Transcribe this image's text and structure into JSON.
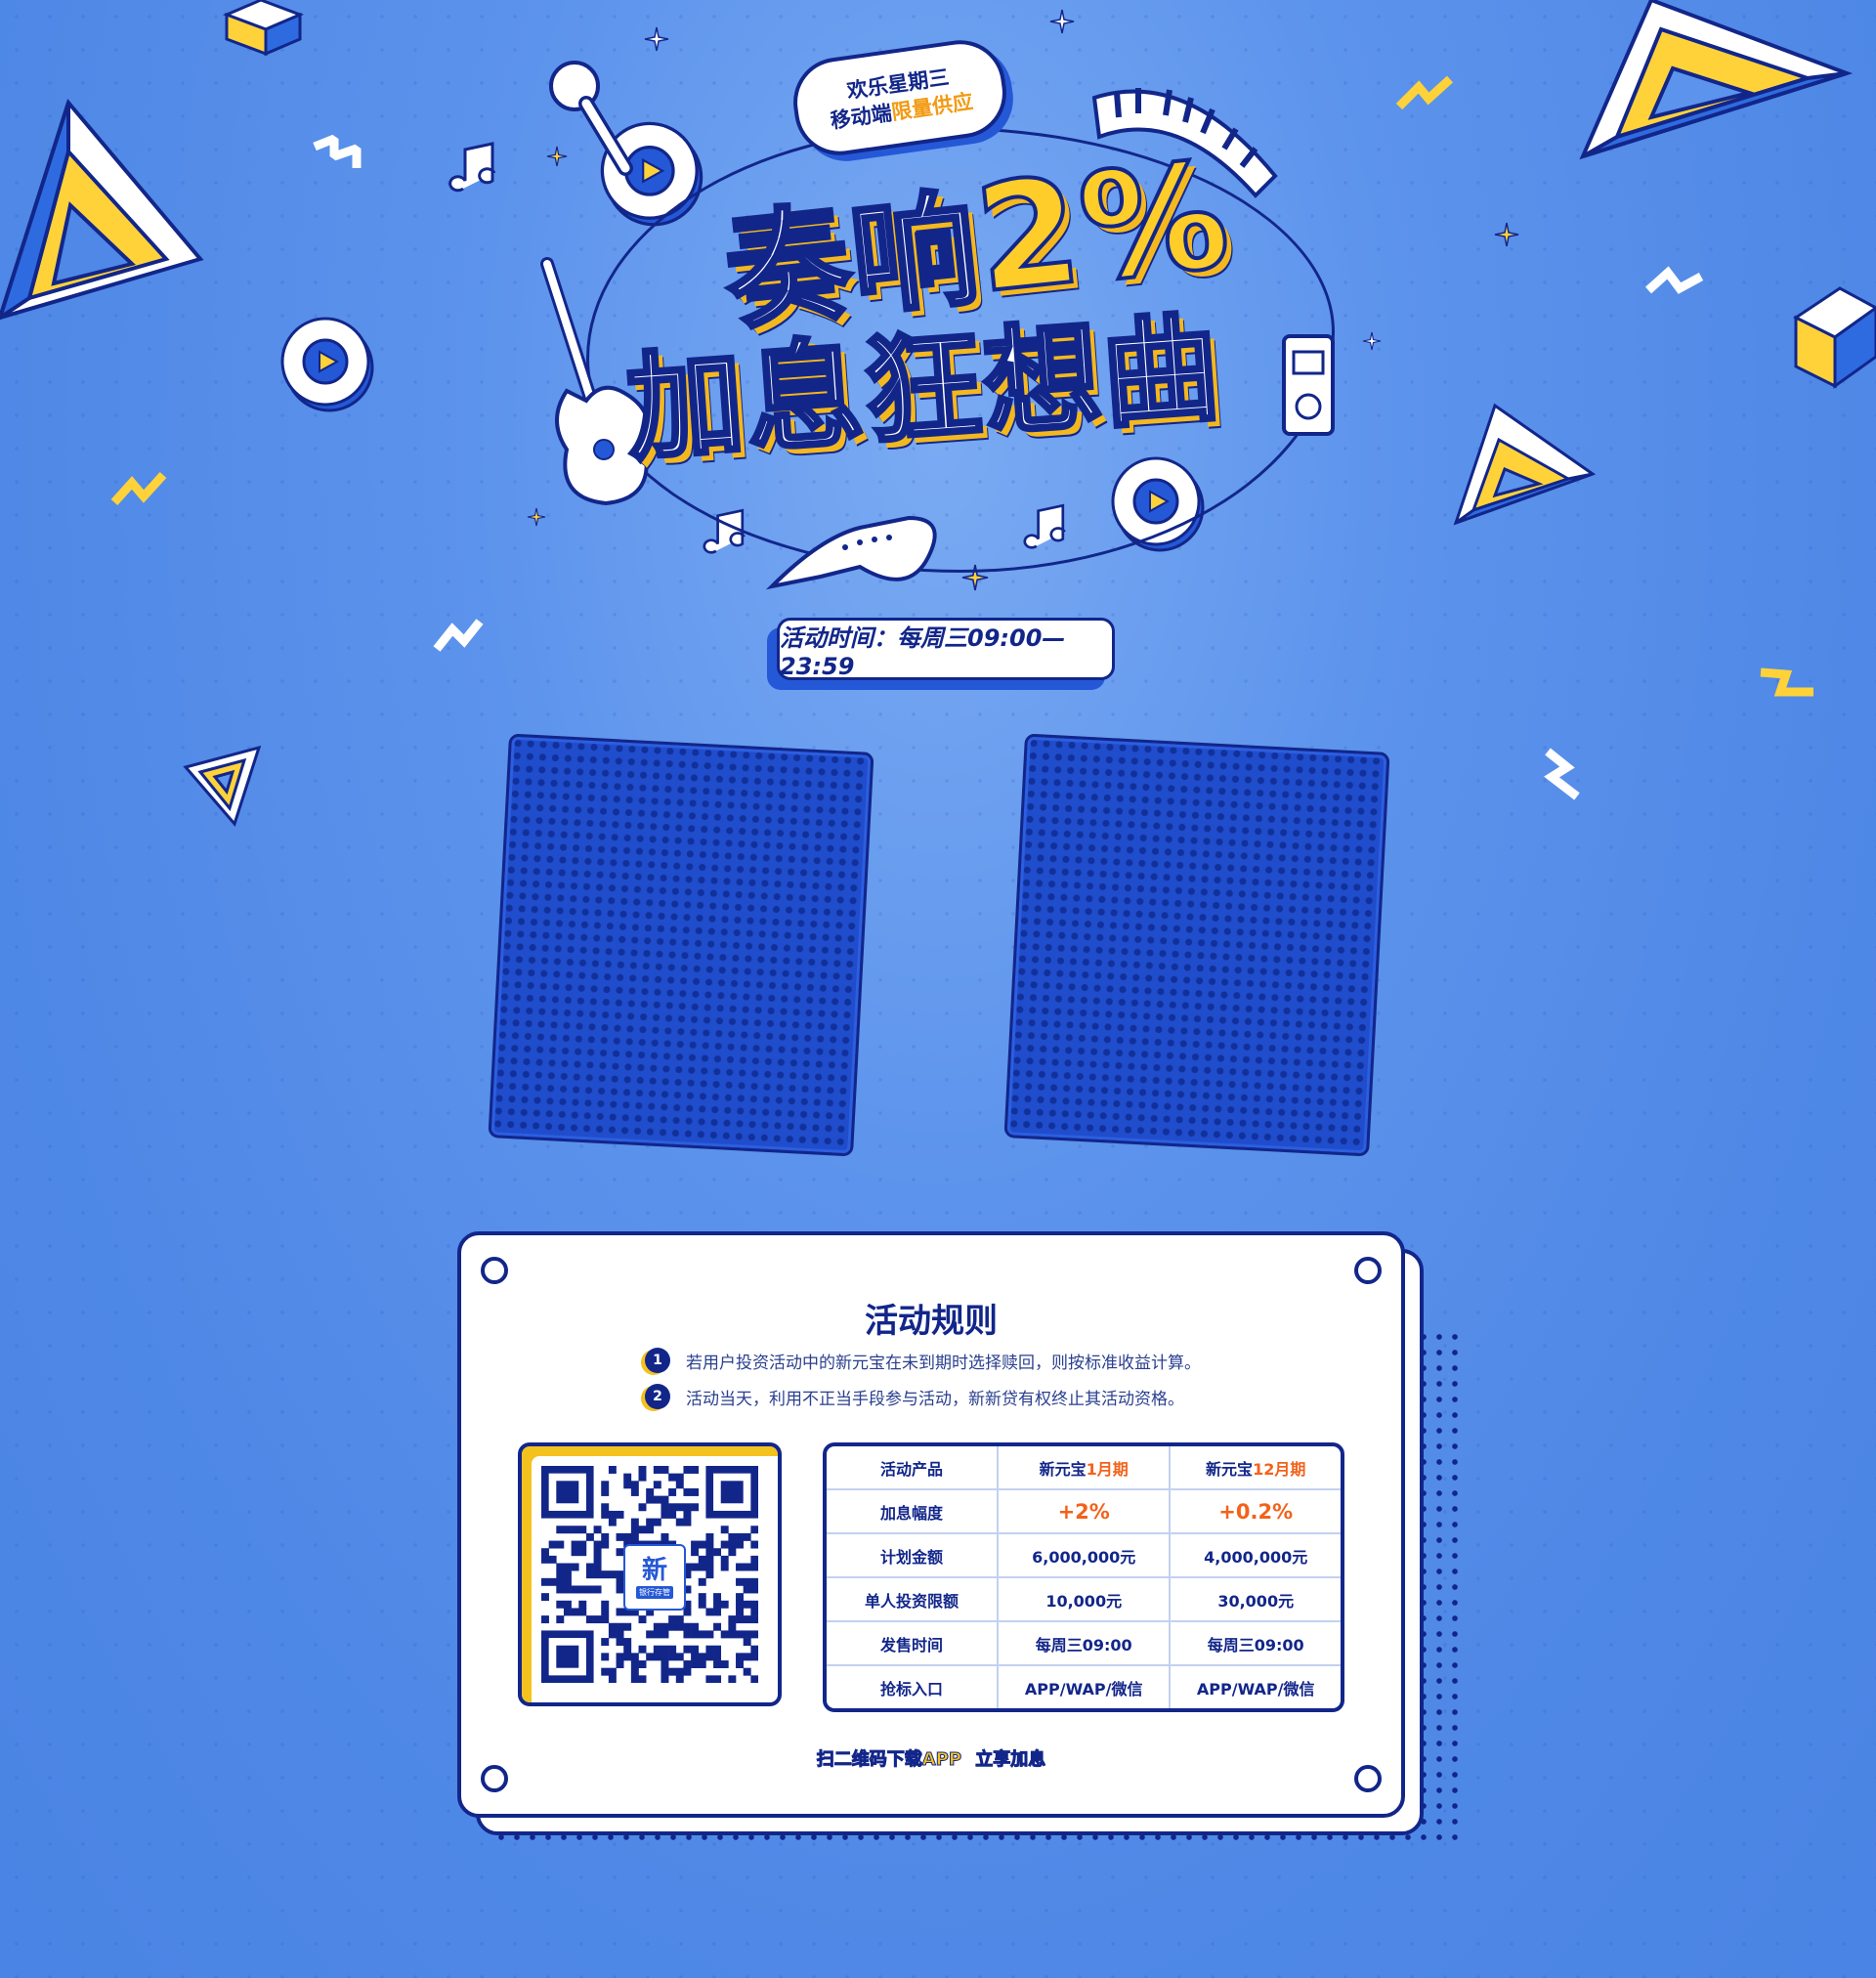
{
  "badge": {
    "line1": "欢乐星期三",
    "line2_prefix": "移动端",
    "line2_highlight": "限量供应"
  },
  "headline": {
    "line1_prefix": "奏响",
    "line1_number": "2%",
    "line2": "加息狂想曲"
  },
  "activity_time": "活动时间：每周三09:00—23:59",
  "rules": {
    "title": "活动规则",
    "items": [
      {
        "num": "1",
        "text": "若用户投资活动中的新元宝在未到期时选择赎回，则按标准收益计算。"
      },
      {
        "num": "2",
        "text": "活动当天，利用不正当手段参与活动，新新贷有权终止其活动资格。"
      }
    ]
  },
  "qr": {
    "logo_char": "新",
    "logo_caption": "银行存管"
  },
  "table": {
    "header": {
      "label": "活动产品",
      "col1_prefix": "新元宝",
      "col1_highlight": "1月期",
      "col2_prefix": "新元宝",
      "col2_highlight": "12月期"
    },
    "rows": [
      {
        "label": "加息幅度",
        "col1": "+2%",
        "col2": "+0.2%"
      },
      {
        "label": "计划金额",
        "col1": "6,000,000元",
        "col2": "4,000,000元"
      },
      {
        "label": "单人投资限额",
        "col1": "10,000元",
        "col2": "30,000元"
      },
      {
        "label": "发售时间",
        "col1": "每周三09:00",
        "col2": "每周三09:00"
      },
      {
        "label": "抢标入口",
        "col1": "APP/WAP/微信",
        "col2": "APP/WAP/微信"
      }
    ]
  },
  "cta": "扫二维码下载APP  立享加息",
  "colors": {
    "navy": "#12268a",
    "blue": "#2458d6",
    "yellow": "#f4c21f",
    "orange": "#f3621a",
    "background": "#5c93ec"
  }
}
